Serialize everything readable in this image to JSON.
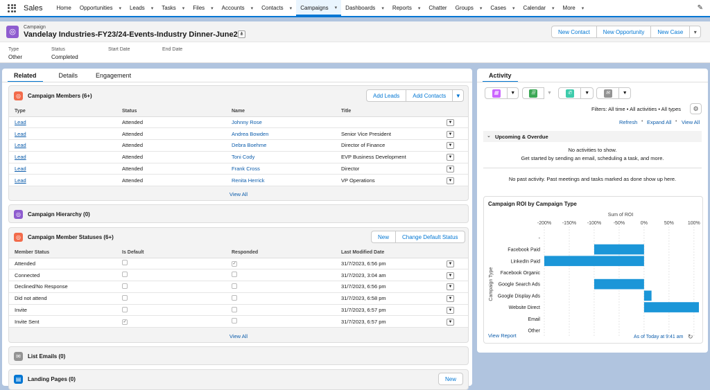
{
  "app": {
    "name": "Sales"
  },
  "nav": {
    "items": [
      {
        "label": "Home",
        "chevron": false
      },
      {
        "label": "Opportunities",
        "chevron": true
      },
      {
        "label": "Leads",
        "chevron": true
      },
      {
        "label": "Tasks",
        "chevron": true
      },
      {
        "label": "Files",
        "chevron": true
      },
      {
        "label": "Accounts",
        "chevron": true
      },
      {
        "label": "Contacts",
        "chevron": true
      },
      {
        "label": "Campaigns",
        "chevron": true,
        "active": true
      },
      {
        "label": "Dashboards",
        "chevron": true
      },
      {
        "label": "Reports",
        "chevron": true
      },
      {
        "label": "Chatter",
        "chevron": false
      },
      {
        "label": "Groups",
        "chevron": true
      },
      {
        "label": "Cases",
        "chevron": true
      },
      {
        "label": "Calendar",
        "chevron": true
      },
      {
        "label": "More",
        "chevron": true
      }
    ]
  },
  "record": {
    "object": "Campaign",
    "title": "Vandelay Industries-FY23/24-Events-Industry Dinner-June23",
    "actions": {
      "new_contact": "New Contact",
      "new_opportunity": "New Opportunity",
      "new_case": "New Case"
    },
    "fields": [
      {
        "label": "Type",
        "value": "Other"
      },
      {
        "label": "Status",
        "value": "Completed"
      },
      {
        "label": "Start Date",
        "value": ""
      },
      {
        "label": "End Date",
        "value": ""
      }
    ]
  },
  "tabs": [
    "Related",
    "Details",
    "Engagement"
  ],
  "members": {
    "title": "Campaign Members (6+)",
    "add_leads": "Add Leads",
    "add_contacts": "Add Contacts",
    "columns": [
      "Type",
      "Status",
      "Name",
      "Title"
    ],
    "rows": [
      {
        "type": "Lead",
        "status": "Attended",
        "name": "Johnny Rose",
        "title": ""
      },
      {
        "type": "Lead",
        "status": "Attended",
        "name": "Andrea Bowden",
        "title": "Senior Vice President"
      },
      {
        "type": "Lead",
        "status": "Attended",
        "name": "Debra Boehme",
        "title": "Director of Finance"
      },
      {
        "type": "Lead",
        "status": "Attended",
        "name": "Toni Cody",
        "title": "EVP Business Development"
      },
      {
        "type": "Lead",
        "status": "Attended",
        "name": "Frank Cross",
        "title": "Director"
      },
      {
        "type": "Lead",
        "status": "Attended",
        "name": "Renita Herrick",
        "title": "VP Operations"
      }
    ],
    "view_all": "View All"
  },
  "hierarchy": {
    "title": "Campaign Hierarchy (0)"
  },
  "statuses": {
    "title": "Campaign Member Statuses (6+)",
    "new_label": "New",
    "change_default": "Change Default Status",
    "columns": [
      "Member Status",
      "Is Default",
      "Responded",
      "Last Modified Date"
    ],
    "rows": [
      {
        "status": "Attended",
        "is_default": false,
        "responded": true,
        "modified": "31/7/2023, 6:56 pm"
      },
      {
        "status": "Connected",
        "is_default": false,
        "responded": false,
        "modified": "31/7/2023, 3:04 am"
      },
      {
        "status": "Declined/No Response",
        "is_default": false,
        "responded": false,
        "modified": "31/7/2023, 6:56 pm"
      },
      {
        "status": "Did not attend",
        "is_default": false,
        "responded": false,
        "modified": "31/7/2023, 6:58 pm"
      },
      {
        "status": "Invite",
        "is_default": false,
        "responded": false,
        "modified": "31/7/2023, 6:57 pm"
      },
      {
        "status": "Invite Sent",
        "is_default": true,
        "responded": false,
        "modified": "31/7/2023, 6:57 pm"
      }
    ],
    "view_all": "View All"
  },
  "list_emails": {
    "title": "List Emails (0)"
  },
  "landing_pages": {
    "title": "Landing Pages (0)",
    "new_label": "New"
  },
  "activity": {
    "tab": "Activity",
    "filters": "Filters: All time • All activities • All types",
    "refresh": "Refresh",
    "expand_all": "Expand All",
    "view_all": "View All",
    "upcoming_title": "Upcoming & Overdue",
    "no_activities": "No activities to show.",
    "get_started": "Get started by sending an email, scheduling a task, and more.",
    "no_past": "No past activity. Past meetings and tasks marked as done show up here."
  },
  "chart_card": {
    "title": "Campaign ROI by Campaign Type",
    "view_report": "View Report",
    "as_of": "As of Today at 9:41 am"
  },
  "colors": {
    "brand": "#0176d3",
    "bar": "#1b96d8",
    "campaign_icon": "#8e5ccf",
    "members_icon": "#f26b4b"
  },
  "chart_data": {
    "type": "bar",
    "orientation": "horizontal",
    "title": "Campaign ROI by Campaign Type",
    "xlabel": "Sum of ROI",
    "ylabel": "Campaign Type",
    "x_ticks": [
      "-200%",
      "-150%",
      "-100%",
      "-50%",
      "0%",
      "50%",
      "100%"
    ],
    "xlim": [
      -200,
      110
    ],
    "categories": [
      "-",
      "Facebook Paid",
      "LinkedIn Paid",
      "Facebook Organic",
      "Google Search Ads",
      "Google Display Ads",
      "Website Direct",
      "Email",
      "Other"
    ],
    "values": [
      0,
      -100,
      -200,
      0,
      -100,
      15,
      110,
      0,
      0
    ],
    "grid": true
  }
}
